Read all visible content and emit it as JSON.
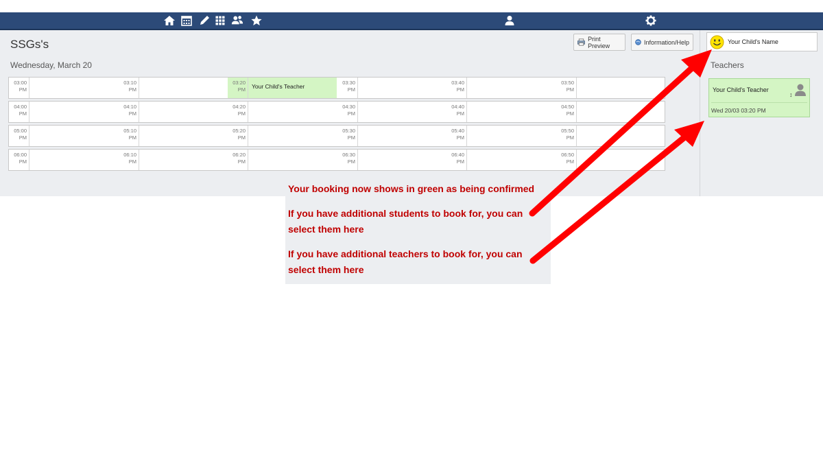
{
  "nav": {
    "icons": [
      "home-icon",
      "calendar-icon",
      "pencil-icon",
      "grid-icon",
      "people-icon",
      "star-icon",
      "user-icon",
      "gear-icon"
    ]
  },
  "page": {
    "title": "SSGs's",
    "date": "Wednesday, March 20"
  },
  "toolbar": {
    "print_label": "Print Preview",
    "info_label": "Information/Help"
  },
  "child": {
    "name": "Your Child's Name"
  },
  "teachers_panel": {
    "heading": "Teachers",
    "card": {
      "name": "Your Child's Teacher",
      "time": "Wed 20/03 03:20 PM",
      "caret": "↕"
    }
  },
  "slots": {
    "rows": [
      [
        {
          "t": "03:00",
          "p": "PM",
          "label": ""
        },
        {
          "t": "03:10",
          "p": "PM",
          "label": ""
        },
        {
          "t": "03:20",
          "p": "PM",
          "label": "Your Child's Teacher",
          "booked": true
        },
        {
          "t": "03:30",
          "p": "PM",
          "label": ""
        },
        {
          "t": "03:40",
          "p": "PM",
          "label": ""
        },
        {
          "t": "03:50",
          "p": "PM",
          "label": ""
        }
      ],
      [
        {
          "t": "04:00",
          "p": "PM",
          "label": ""
        },
        {
          "t": "04:10",
          "p": "PM",
          "label": ""
        },
        {
          "t": "04:20",
          "p": "PM",
          "label": ""
        },
        {
          "t": "04:30",
          "p": "PM",
          "label": ""
        },
        {
          "t": "04:40",
          "p": "PM",
          "label": ""
        },
        {
          "t": "04:50",
          "p": "PM",
          "label": ""
        }
      ],
      [
        {
          "t": "05:00",
          "p": "PM",
          "label": ""
        },
        {
          "t": "05:10",
          "p": "PM",
          "label": ""
        },
        {
          "t": "05:20",
          "p": "PM",
          "label": ""
        },
        {
          "t": "05:30",
          "p": "PM",
          "label": ""
        },
        {
          "t": "05:40",
          "p": "PM",
          "label": ""
        },
        {
          "t": "05:50",
          "p": "PM",
          "label": ""
        }
      ],
      [
        {
          "t": "06:00",
          "p": "PM",
          "label": ""
        },
        {
          "t": "06:10",
          "p": "PM",
          "label": ""
        },
        {
          "t": "06:20",
          "p": "PM",
          "label": ""
        },
        {
          "t": "06:30",
          "p": "PM",
          "label": ""
        },
        {
          "t": "06:40",
          "p": "PM",
          "label": ""
        },
        {
          "t": "06:50",
          "p": "PM",
          "label": ""
        }
      ]
    ]
  },
  "callout": {
    "line1": "Your booking now shows in green as being confirmed",
    "line2a": "If you have additional students to book for, you can",
    "line2b": "select them here",
    "line3a": "If you have additional teachers to book for, you can",
    "line3b": "select them here"
  },
  "colors": {
    "nav": "#2c4a78",
    "booked": "#d4f5c4",
    "callout_text": "#c00000",
    "arrow": "#ff0000"
  }
}
